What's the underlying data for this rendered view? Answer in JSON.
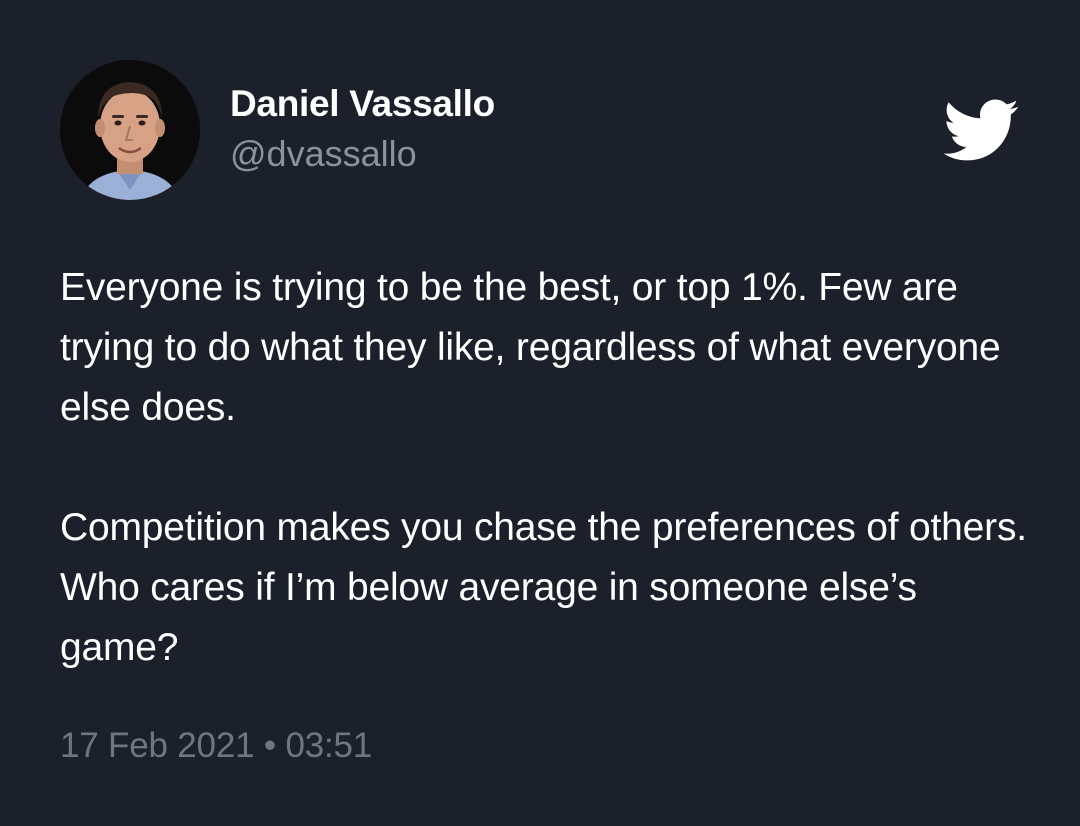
{
  "author": {
    "display_name": "Daniel Vassallo",
    "handle": "@dvassallo",
    "avatar_icon": "profile-photo"
  },
  "brand_icon": "twitter-bird-icon",
  "tweet": {
    "paragraphs": [
      "Everyone is trying to be the best, or top 1%. Few are trying to do what they like, regardless of what everyone else does.",
      "Competition makes you chase the preferences of others. Who cares if I’m below average in someone else’s game?"
    ],
    "date": "17 Feb 2021",
    "separator": "•",
    "time": "03:51"
  },
  "colors": {
    "background": "#1b202a",
    "text": "#ffffff",
    "secondary": "#8a939d"
  }
}
